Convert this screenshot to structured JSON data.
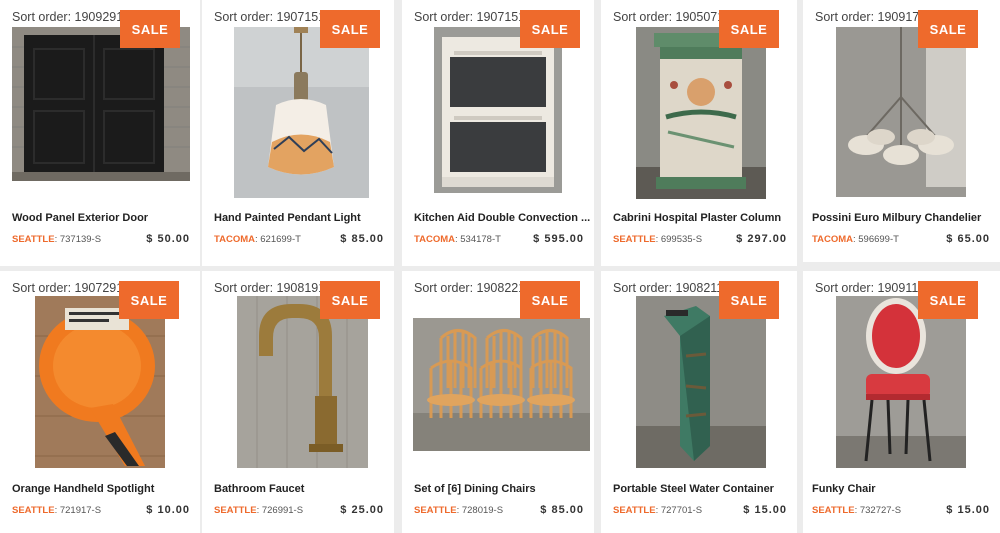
{
  "listings": [
    {
      "sort_order": "Sort order: 19092913",
      "badge": "SALE",
      "title": "Wood Panel Exterior Door",
      "city": "SEATTLE",
      "sku": ": 737139-S",
      "price": "$ 50.00",
      "image": "black double door on brick wall"
    },
    {
      "sort_order": "Sort order: 19071511",
      "badge": "SALE",
      "title": "Hand Painted Pendant Light",
      "city": "TACOMA",
      "sku": ": 621699-T",
      "price": "$ 85.00",
      "image": "brass pendant with painted glass shade"
    },
    {
      "sort_order": "Sort order: 19071511",
      "badge": "SALE",
      "title": "Kitchen Aid Double Convection ...",
      "city": "TACOMA",
      "sku": ": 534178-T",
      "price": "$ 595.00",
      "image": "white double wall oven"
    },
    {
      "sort_order": "Sort order: 19050710",
      "badge": "SALE",
      "title": "Cabrini Hospital Plaster Column",
      "city": "SEATTLE",
      "sku": ": 699535-S",
      "price": "$ 297.00",
      "image": "decorated plaster column"
    },
    {
      "sort_order": "Sort order: 19091712",
      "badge": "SALE",
      "title": "Possini Euro Milbury Chandelier",
      "city": "TACOMA",
      "sku": ": 596699-T",
      "price": "$ 65.00",
      "image": "brushed nickel chandelier"
    },
    {
      "sort_order": "Sort order: 19072912",
      "badge": "SALE",
      "title": "Orange Handheld Spotlight",
      "city": "SEATTLE",
      "sku": ": 721917-S",
      "price": "$ 10.00",
      "image": "orange handheld spotlight"
    },
    {
      "sort_order": "Sort order: 19081917",
      "badge": "SALE",
      "title": "Bathroom Faucet",
      "city": "SEATTLE",
      "sku": ": 726991-S",
      "price": "$ 25.00",
      "image": "brass gooseneck faucet"
    },
    {
      "sort_order": "Sort order: 19082213",
      "badge": "SALE",
      "title": "Set of [6] Dining Chairs",
      "city": "SEATTLE",
      "sku": ": 728019-S",
      "price": "$ 85.00",
      "image": "six wooden windsor chairs"
    },
    {
      "sort_order": "Sort order: 19082117",
      "badge": "SALE",
      "title": "Portable Steel Water Container",
      "city": "SEATTLE",
      "sku": ": 727701-S",
      "price": "$ 15.00",
      "image": "green steel water container"
    },
    {
      "sort_order": "Sort order: 19091116",
      "badge": "SALE",
      "title": "Funky Chair",
      "city": "SEATTLE",
      "sku": ": 732727-S",
      "price": "$ 15.00",
      "image": "red upholstered chair"
    }
  ],
  "colors": {
    "accent": "#ee6a2c",
    "card": "#ffffff",
    "background": "#ececec"
  }
}
